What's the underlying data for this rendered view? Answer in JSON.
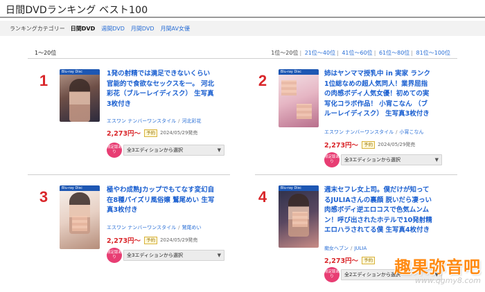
{
  "page": {
    "title": "日間DVDランキング ベスト100"
  },
  "category_bar": {
    "label": "ランキングカテゴリー",
    "tabs": [
      {
        "label": "日間DVD",
        "active": true
      },
      {
        "label": "週間DVD",
        "active": false
      },
      {
        "label": "月間DVD",
        "active": false
      },
      {
        "label": "月間AV女優",
        "active": false
      }
    ]
  },
  "range": {
    "current": "1～20位",
    "pages": [
      "1位～20位",
      "21位～40位",
      "41位～60位",
      "61位～80位",
      "81位～100位"
    ]
  },
  "items": [
    {
      "rank": "1",
      "cover_badge": "Blu-ray Disc",
      "title": "1発の射精では満足できないくらい 官能的で食欲なセックスを一。 河北彩花（ブルーレイディスク） 生写真3枚付き",
      "maker": "エスワン ナンバーワンスタイル",
      "actress": "河北彩花",
      "price": "2,273円～",
      "status": "予約",
      "release": "2024/05/29発売",
      "limited": "限定版あり",
      "select": "全3エディションから選択",
      "caret": "▼"
    },
    {
      "rank": "2",
      "cover_badge": "Blu-ray Disc",
      "title": "姉はヤンママ授乳中 in 実家 ランク1位総なめの超人気同人！業界屈指の肉感ボディ人気女優！初めての実写化コラボ作品！ 小宵こなん （ブルーレイディスク） 生写真3枚付き",
      "maker": "エスワン ナンバーワンスタイル",
      "actress": "小宵こなん",
      "price": "2,273円～",
      "status": "予約",
      "release": "2024/05/29発売",
      "limited": "限定版あり",
      "select": "全3エディションから選択",
      "caret": "▼"
    },
    {
      "rank": "3",
      "cover_badge": "Blu-ray Disc",
      "title": "極やわ成熟Jカップでもてなす変幻自在8種パイズリ風俗嬢 鷲尾めい 生写真3枚付き",
      "maker": "エスワン ナンバーワンスタイル",
      "actress": "鷲尾めい",
      "price": "2,273円～",
      "status": "予約",
      "release": "2024/05/29発売",
      "limited": "限定版あり",
      "select": "全3エディションから選択",
      "caret": "▼"
    },
    {
      "rank": "4",
      "cover_badge": "Blu-ray Disc",
      "title": "週末セフレ女上司。僕だけが知ってるJULIAさんの裏顔 脱いだら凄っい肉感ボディ逆エロコスで色気ムンムン！呼び出されたホテルで10発射精エロハラされてる僕 生写真4枚付き",
      "maker": "痴女ヘブン",
      "actress": "JULIA",
      "price": "2,273円～",
      "status": "予約",
      "release": "",
      "limited": "限定版あり",
      "select": "全2エディションから選択",
      "caret": "▼"
    }
  ],
  "watermark": {
    "text": "趣果弥音吧",
    "url": "www.qgmy8.com"
  },
  "colors": {
    "rank": "#d9262a",
    "link": "#1a5fd0",
    "limited": "#e83d73",
    "watermark": "#ff8a12"
  }
}
